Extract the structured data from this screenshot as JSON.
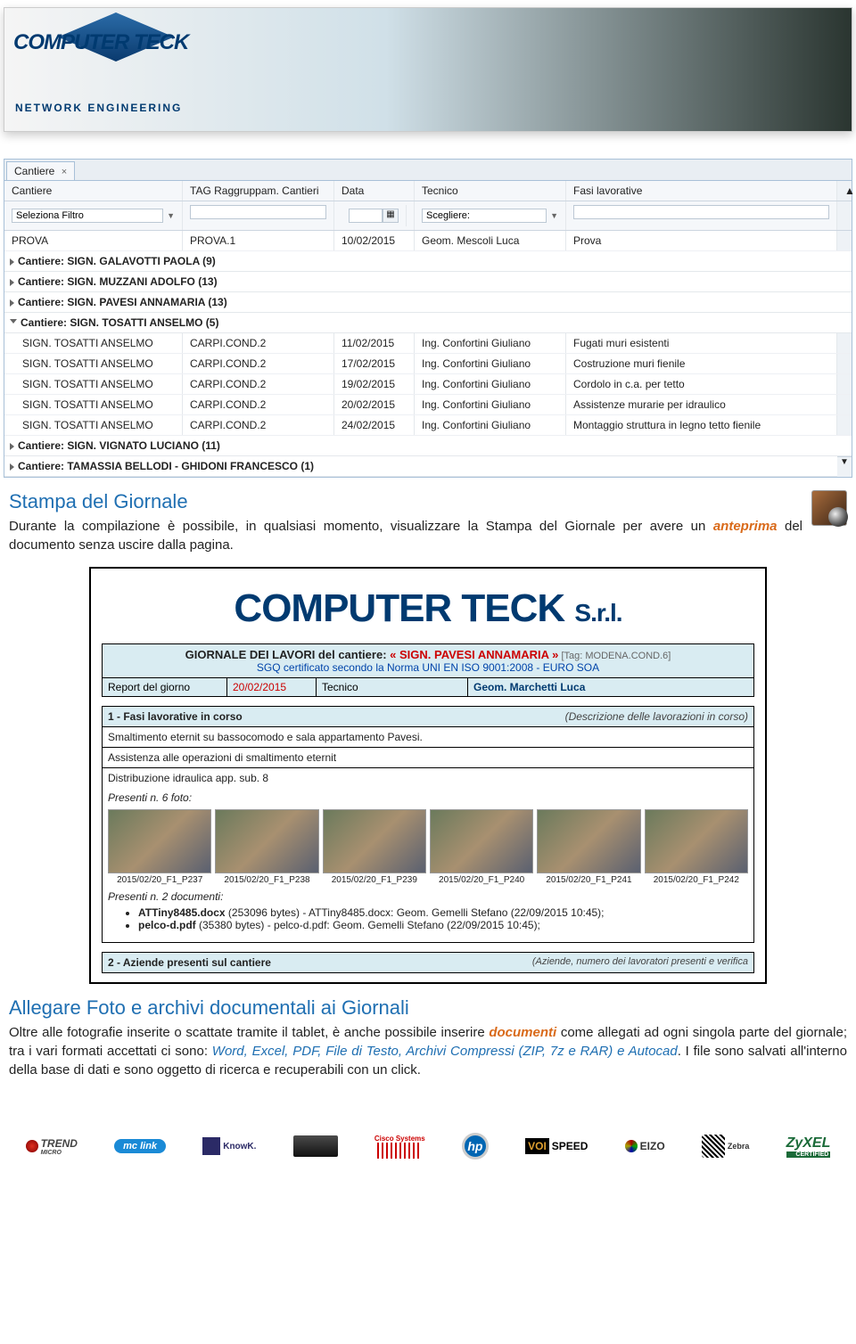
{
  "banner": {
    "logo_text": "COMPUTER TECK",
    "sub_text": "NETWORK ENGINEERING"
  },
  "grid": {
    "tab_label": "Cantiere",
    "headers": {
      "cantiere": "Cantiere",
      "tag": "TAG Raggruppam. Cantieri",
      "data": "Data",
      "tecnico": "Tecnico",
      "fasi": "Fasi lavorative"
    },
    "filters": {
      "seleziona_placeholder": "Seleziona Filtro",
      "scegliere_placeholder": "Scegliere:"
    },
    "top_row": {
      "cantiere": "PROVA",
      "tag": "PROVA.1",
      "data": "10/02/2015",
      "tecnico": "Geom. Mescoli Luca",
      "fasi": "Prova"
    },
    "groups_closed": [
      "Cantiere: SIGN. GALAVOTTI PAOLA (9)",
      "Cantiere: SIGN. MUZZANI ADOLFO (13)",
      "Cantiere: SIGN. PAVESI ANNAMARIA (13)"
    ],
    "group_open": "Cantiere: SIGN. TOSATTI ANSELMO (5)",
    "rows": [
      {
        "c": "SIGN. TOSATTI ANSELMO",
        "t": "CARPI.COND.2",
        "d": "11/02/2015",
        "te": "Ing. Confortini Giuliano",
        "f": "Fugati muri esistenti"
      },
      {
        "c": "SIGN. TOSATTI ANSELMO",
        "t": "CARPI.COND.2",
        "d": "17/02/2015",
        "te": "Ing. Confortini Giuliano",
        "f": "Costruzione muri fienile"
      },
      {
        "c": "SIGN. TOSATTI ANSELMO",
        "t": "CARPI.COND.2",
        "d": "19/02/2015",
        "te": "Ing. Confortini Giuliano",
        "f": "Cordolo in c.a. per tetto"
      },
      {
        "c": "SIGN. TOSATTI ANSELMO",
        "t": "CARPI.COND.2",
        "d": "20/02/2015",
        "te": "Ing. Confortini Giuliano",
        "f": "Assistenze murarie per idraulico"
      },
      {
        "c": "SIGN. TOSATTI ANSELMO",
        "t": "CARPI.COND.2",
        "d": "24/02/2015",
        "te": "Ing. Confortini Giuliano",
        "f": "Montaggio struttura in legno tetto fienile"
      }
    ],
    "groups_closed_after": [
      "Cantiere: SIGN. VIGNATO LUCIANO (11)",
      "Cantiere: TAMASSIA BELLODI - GHIDONI FRANCESCO (1)"
    ]
  },
  "section1": {
    "title": "Stampa del Giornale",
    "text_pre": "Durante la compilazione è possibile, in qualsiasi momento, visualizzare la Stampa del Giornale per avere un ",
    "text_em": "anteprima",
    "text_post": " del documento senza uscire dalla pagina."
  },
  "report": {
    "logo": "COMPUTER TECK ",
    "logo_suffix": "S.r.l.",
    "head_pre": "GIORNALE DEI LAVORI del cantiere: ",
    "head_red": "« SIGN. PAVESI ANNAMARIA »",
    "head_tag": "   [Tag: MODENA.COND.6]",
    "head_line2": "SGQ certificato secondo la Norma UNI EN ISO 9001:2008 - EURO SOA",
    "info_lbl1": "Report del giorno",
    "info_val1": "20/02/2015",
    "info_lbl2": "Tecnico",
    "info_val2": "Geom. Marchetti Luca",
    "sec1_t": "1 - Fasi lavorative in corso",
    "sec1_d": "(Descrizione delle lavorazioni in corso)",
    "body_lines": [
      "Smaltimento eternit su bassocomodo e sala appartamento Pavesi.",
      "Assistenza alle operazioni di smaltimento eternit",
      "Distribuzione idraulica app. sub. 8"
    ],
    "foto_presenti": "Presenti n. 6 foto:",
    "thumbs": [
      "2015/02/20_F1_P237",
      "2015/02/20_F1_P238",
      "2015/02/20_F1_P239",
      "2015/02/20_F1_P240",
      "2015/02/20_F1_P241",
      "2015/02/20_F1_P242"
    ],
    "doc_presenti": "Presenti n. 2 documenti:",
    "docs": [
      {
        "b": "ATTiny8485.docx",
        "rest": " (253096 bytes) - ATTiny8485.docx: Geom. Gemelli Stefano (22/09/2015 10:45);"
      },
      {
        "b": "pelco-d.pdf",
        "rest": " (35380 bytes) - pelco-d.pdf: Geom. Gemelli Stefano (22/09/2015 10:45);"
      }
    ],
    "sec2_t": "2 - Aziende presenti sul cantiere",
    "sec2_d": "(Aziende, numero dei lavoratori presenti e verifica"
  },
  "section2": {
    "title": "Allegare Foto e archivi documentali ai Giornali",
    "t1": "Oltre alle fotografie inserite o scattate tramite il tablet, è anche possibile inserire ",
    "t2": "documenti",
    "t3": " come allegati ad ogni singola parte del giornale; tra i vari formati accettati ci sono: ",
    "t4": "Word, Excel, PDF, File di Testo, Archivi Compressi (ZIP, 7z e RAR) e Autocad",
    "t5": ". I file sono salvati all'interno della base di dati e sono oggetto di ricerca e recuperabili con un click."
  },
  "footer": {
    "trend": "TREND",
    "trend_sub": "MICRO",
    "mclink": "mc link",
    "knowk": "KnowK.",
    "cisco": "Cisco Systems",
    "hp": "hp",
    "voispeed_v": "VOI",
    "voispeed_s": "SPEED",
    "eizo": "EIZO",
    "zebra": "Zebra",
    "zyxel": "ZyXEL",
    "zyxel_cert": "CERTIFIED"
  }
}
